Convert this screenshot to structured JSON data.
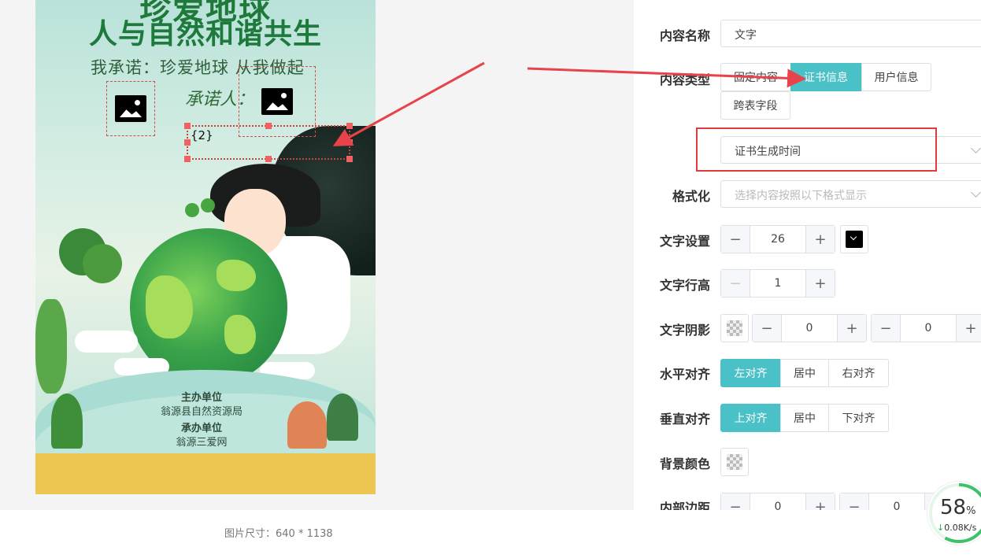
{
  "poster": {
    "title_line1": "珍爱地球",
    "title_line2": "人与自然和谐共生",
    "pledge": "我承诺：珍爱地球 从我做起",
    "signer": "承诺人：",
    "text_placeholder": "{2}",
    "host_label": "主办单位",
    "host_name": "翁源县自然资源局",
    "co_label": "承办单位",
    "co_name": "翁源三爱网"
  },
  "image_size_text": "图片尺寸：640 * 1138",
  "panel": {
    "content_name_label": "内容名称",
    "content_name_value": "文字",
    "content_type_label": "内容类型",
    "content_type_options": [
      "固定内容",
      "证书信息",
      "用户信息",
      "跨表字段"
    ],
    "content_type_selected": "证书信息",
    "cert_field_value": "证书生成时间",
    "format_label": "格式化",
    "format_placeholder": "选择内容按照以下格式显示",
    "text_setting_label": "文字设置",
    "font_size": "26",
    "line_height_label": "文字行高",
    "line_height": "1",
    "shadow_label": "文字阴影",
    "shadow_x": "0",
    "shadow_y": "0",
    "h_align_label": "水平对齐",
    "h_align_options": [
      "左对齐",
      "居中",
      "右对齐"
    ],
    "h_align_selected": "左对齐",
    "v_align_label": "垂直对齐",
    "v_align_options": [
      "上对齐",
      "居中",
      "下对齐"
    ],
    "v_align_selected": "上对齐",
    "bg_color_label": "背景颜色",
    "padding_label": "内部边距",
    "padding_a": "0",
    "padding_b": "0"
  },
  "speed": {
    "percent": "58",
    "percent_sign": "%",
    "rate": "0.08K/s"
  },
  "colors": {
    "accent": "#4ac1c7",
    "highlight": "#e03c3c",
    "poster_title": "#1f7a3a"
  }
}
